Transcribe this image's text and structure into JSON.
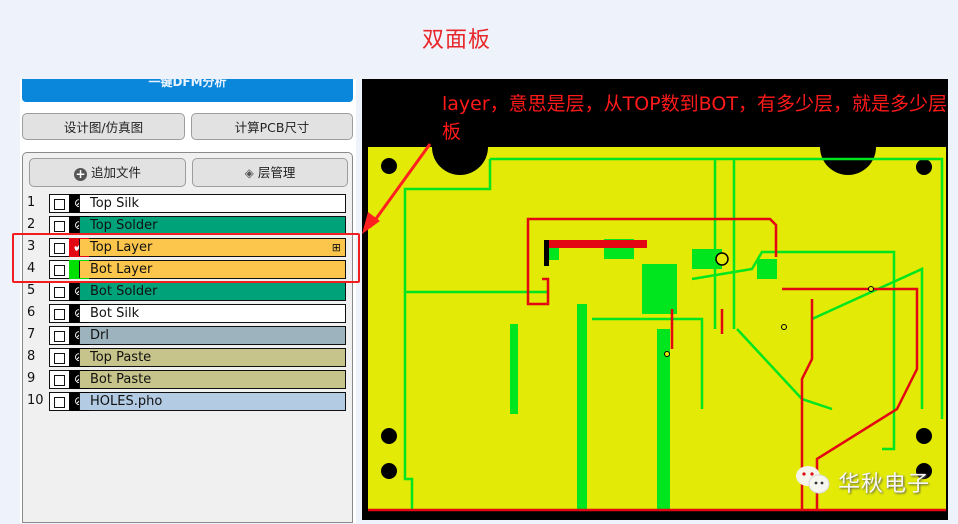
{
  "page_title": "双面板",
  "left_panel": {
    "dfm_button": "一键DFM分析",
    "design_button": "设计图/仿真图",
    "calc_button": "计算PCB尺寸",
    "add_file_button": "追加文件",
    "layer_manage_button": "层管理",
    "layers": [
      {
        "index": "1",
        "name": "Top Silk",
        "color": "#ffffff",
        "visible_icon": "eye-slash"
      },
      {
        "index": "2",
        "name": "Top Solder",
        "color": "#00a27a",
        "visible_icon": "eye-slash"
      },
      {
        "index": "3",
        "name": "Top Layer",
        "color": "#fcc64c",
        "visible_icon": "checkmark",
        "swatch": "#e30613"
      },
      {
        "index": "4",
        "name": "Bot Layer",
        "color": "#fcc64c",
        "visible_icon": "none",
        "swatch": "#00e000"
      },
      {
        "index": "5",
        "name": "Bot Solder",
        "color": "#00a27a",
        "visible_icon": "eye-slash"
      },
      {
        "index": "6",
        "name": "Bot Silk",
        "color": "#ffffff",
        "visible_icon": "eye-slash"
      },
      {
        "index": "7",
        "name": "Drl",
        "color": "#9db3bd",
        "visible_icon": "eye-slash"
      },
      {
        "index": "8",
        "name": "Top Paste",
        "color": "#c6c48a",
        "visible_icon": "eye-slash"
      },
      {
        "index": "9",
        "name": "Bot Paste",
        "color": "#c6c48a",
        "visible_icon": "eye-slash"
      },
      {
        "index": "10",
        "name": "HOLES.pho",
        "color": "#b3cbe3",
        "visible_icon": "eye-slash"
      }
    ]
  },
  "annotation": {
    "text": "layer，意思是层，从TOP数到BOT，有多少层，就是多少层板",
    "color": "#ff1a1a"
  },
  "pcb_view": {
    "board_color": "#e2ea05",
    "top_trace_color": "#e30613",
    "bottom_trace_color": "#00e61e",
    "background": "#000000"
  },
  "watermark": {
    "text": "华秋电子"
  }
}
